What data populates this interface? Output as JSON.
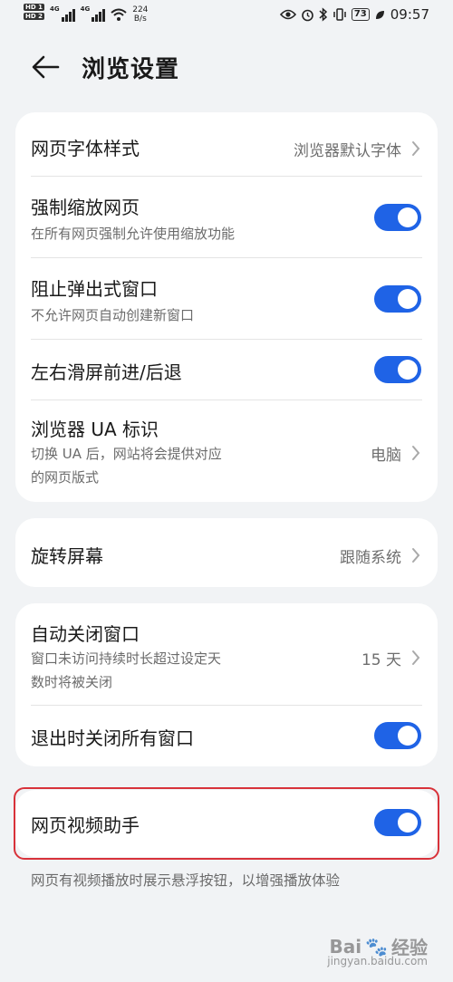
{
  "status_bar": {
    "hd1": "HD 1",
    "hd2": "HD 2",
    "net1": "4G",
    "net2": "4G",
    "speed_value": "224",
    "speed_unit": "B/s",
    "battery": "73",
    "time": "09:57"
  },
  "header": {
    "title": "浏览设置"
  },
  "cards": {
    "c1": {
      "font_style": {
        "label": "网页字体样式",
        "value": "浏览器默认字体"
      },
      "force_zoom": {
        "label": "强制缩放网页",
        "sub": "在所有网页强制允许使用缩放功能",
        "on": true
      },
      "block_popup": {
        "label": "阻止弹出式窗口",
        "sub": "不允许网页自动创建新窗口",
        "on": true
      },
      "swipe_nav": {
        "label": "左右滑屏前进/后退",
        "on": true
      },
      "ua": {
        "label": "浏览器 UA 标识",
        "sub1": "切换 UA 后，网站将会提供对应",
        "sub2": "的网页版式",
        "value": "电脑"
      }
    },
    "c2": {
      "rotate": {
        "label": "旋转屏幕",
        "value": "跟随系统"
      }
    },
    "c3": {
      "auto_close": {
        "label": "自动关闭窗口",
        "sub1": "窗口未访问持续时长超过设定天",
        "sub2": "数时将被关闭",
        "value": "15 天"
      },
      "close_on_exit": {
        "label": "退出时关闭所有窗口",
        "on": true
      }
    },
    "c4": {
      "video_helper": {
        "label": "网页视频助手",
        "on": true
      }
    }
  },
  "footnote": "网页有视频播放时展示悬浮按钮，以增强播放体验",
  "watermark": {
    "brand": "Bai",
    "paw": "🐾",
    "suffix": "经验",
    "url": "jingyan.baidu.com"
  },
  "colors": {
    "accent": "#1f63e6",
    "highlight_border": "#d8323a",
    "background": "#f1f3f5"
  }
}
